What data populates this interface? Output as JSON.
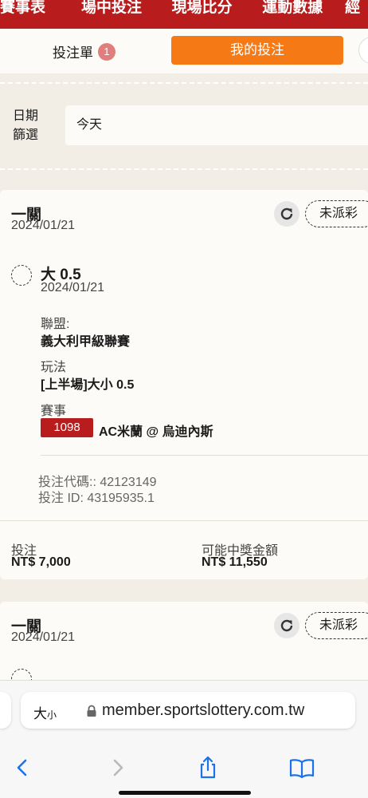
{
  "topnav": {
    "items": [
      "賽事表",
      "場中投注",
      "現場比分",
      "運動數據",
      "經"
    ]
  },
  "tabs": {
    "betslip_label": "投注單",
    "betslip_count": "1",
    "mybets_label": "我的投注"
  },
  "date_filter": {
    "label_line1": "日期",
    "label_line2": "篩選",
    "value": "今天"
  },
  "bets": [
    {
      "type": "一關",
      "date": "2024/01/21",
      "status": "未派彩",
      "leg": {
        "pick": "大 0.5",
        "date": "2024/01/21",
        "league_label": "聯盟:",
        "league": "義大利甲級聯賽",
        "market_label": "玩法",
        "market": "[上半場]大小 0.5",
        "event_label": "賽事",
        "match_id": "1098",
        "match": "AC米蘭 @ 烏迪內斯"
      },
      "bet_code": "投注代碼:: 42123149",
      "bet_id": "投注 ID: 43195935.1",
      "stake_label": "投注",
      "stake": "NT$ 7,000",
      "win_label": "可能中獎金額",
      "potential_win": "NT$ 11,550"
    },
    {
      "type": "一關",
      "date": "2024/01/21",
      "status": "未派彩"
    }
  ],
  "browser": {
    "text_size": "大小",
    "url": "member.sportslottery.com.tw"
  },
  "colors": {
    "nav_red": "#b81c1c",
    "accent_orange": "#f57a16",
    "badge": "#e07d7d",
    "page_bg": "#f2eee6"
  },
  "icons": [
    "refresh-icon",
    "lock-icon",
    "back-icon",
    "forward-icon",
    "share-icon",
    "bookmarks-icon"
  ]
}
